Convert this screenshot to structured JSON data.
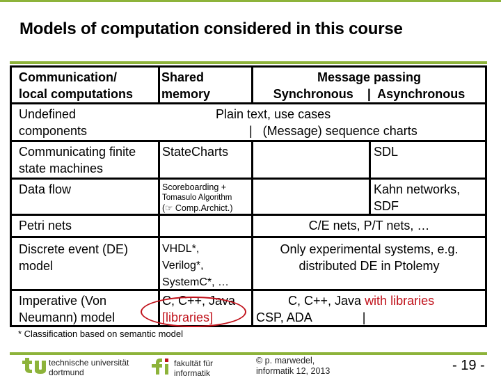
{
  "slide": {
    "title": "Models of computation considered in this course",
    "footnote": "* Classification based on semantic model",
    "accent_color": "#8db33a",
    "highlight_color": "#c0111a"
  },
  "table": {
    "header": {
      "col1": [
        "Communication/",
        "local computations"
      ],
      "col2": [
        "Shared",
        "memory"
      ],
      "col3_title": "Message passing",
      "col3_sub": "Synchronous    |  Asynchronous"
    },
    "rows": [
      {
        "label": [
          "Undefined",
          "components"
        ],
        "span_text": [
          "Plain text, use cases",
          "|   (Message) sequence charts"
        ]
      },
      {
        "label": [
          "Communicating finite",
          "state machines"
        ],
        "shared": "StateCharts",
        "sync": "",
        "async": "SDL"
      },
      {
        "label": [
          "Data flow"
        ],
        "shared": [
          "Scoreboarding +",
          "Tomasulo Algorithm",
          "(☞ Comp.Archict.)"
        ],
        "sync": "",
        "async": [
          "Kahn networks,",
          "SDF"
        ]
      },
      {
        "label": [
          "Petri nets"
        ],
        "shared": "",
        "msg": "C/E nets, P/T nets, …"
      },
      {
        "label": [
          "Discrete event (DE)",
          "model"
        ],
        "shared": [
          "VHDL*,",
          "Verilog*,",
          "SystemC*, …"
        ],
        "msg": [
          "Only experimental systems, e.g.",
          "distributed DE in Ptolemy"
        ]
      },
      {
        "label": [
          "Imperative (Von",
          "Neumann) model"
        ],
        "shared": [
          "C, C++, Java",
          "[libraries]"
        ],
        "msg_line1_plain": "C, C++, Java ",
        "msg_line1_red": "with libraries",
        "msg_line2": "CSP, ADA",
        "msg_line2_sep": "|"
      }
    ]
  },
  "footer": {
    "tu_logo_text": [
      "technische universität",
      "dortmund"
    ],
    "fi_logo_text": [
      "fakultät für",
      "informatik"
    ],
    "copyright": [
      "© p. marwedel,",
      "informatik 12,  2013"
    ],
    "page": "- 19 -"
  }
}
